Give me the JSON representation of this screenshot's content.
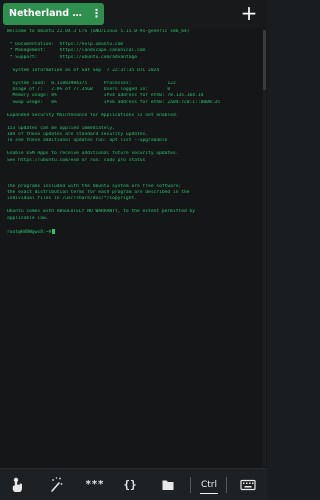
{
  "tab": {
    "title": "Netherland se...",
    "menu_glyph": "⋮",
    "new_tab_glyph": "+"
  },
  "terminal": {
    "lines": [
      "Welcome to Ubuntu 22.04.3 LTS (GNU/Linux 5.15.0-91-generic x86_64)",
      "",
      " * Documentation:  https://help.ubuntu.com",
      " * Management:     https://landscape.canonical.com",
      " * Support:        https://ubuntu.com/advantage",
      "",
      "  System information as of Sat Sep  7 22:37:35 UTC 2024",
      "",
      "  System load:  0.11083984375      Processes:             122",
      "  Usage of /:   2.6% of 77.35GB    Users logged in:       0",
      "  Memory usage: 8%                 IPv4 address for eth0: 78.135.164.14",
      "  Swap usage:   0%                 IPv6 address for eth0: 2a04:7c0:1::8000:35",
      "",
      "Expanded Security Maintenance for Applications is not enabled.",
      "",
      "153 updates can be applied immediately.",
      "104 of these updates are standard security updates.",
      "To see these additional updates run: apt list --upgradable",
      "",
      "Enable ESM Apps to receive additional future security updates.",
      "See https://ubuntu.com/esm or run: sudo pro status",
      "",
      "",
      "",
      "The programs included with the Ubuntu system are free software;",
      "the exact distribution terms for each program are described in the",
      "individual files in /usr/share/doc/*/copyright.",
      "",
      "Ubuntu comes with ABSOLUTELY NO WARRANTY, to the extent permitted by",
      "applicable law.",
      "",
      "root@H4RWgws8:~#"
    ]
  },
  "toolbar": {
    "stars_label": "***",
    "braces_label": "{}",
    "ctrl_label": "Ctrl"
  },
  "icons": {
    "touch": "touch-icon",
    "magic": "magic-wand-icon",
    "folder": "folder-icon",
    "keyboard": "keyboard-icon"
  },
  "colors": {
    "terminal_text": "#2ec26b",
    "tab_active": "#2f8f4e",
    "background": "#141618"
  }
}
